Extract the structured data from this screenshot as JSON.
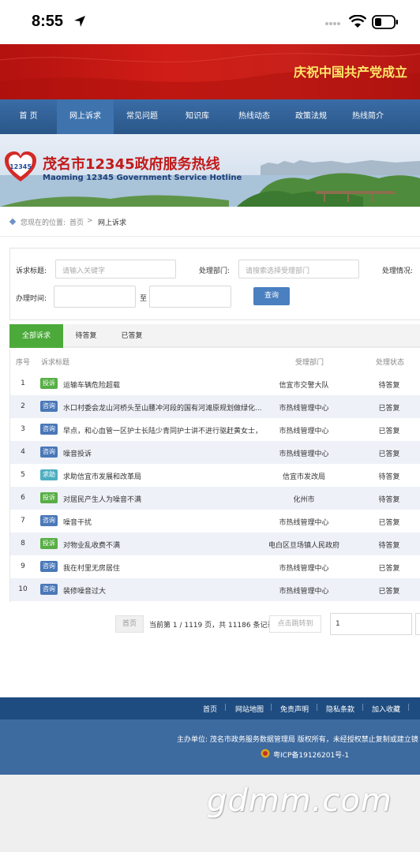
{
  "status_bar": {
    "time": "8:55"
  },
  "banner": {
    "slogan": "庆祝中国共产党成立"
  },
  "nav": {
    "items": [
      "首 页",
      "网上诉求",
      "常见问题",
      "知识库",
      "热线动态",
      "政策法规",
      "热线简介"
    ],
    "active": "网上诉求"
  },
  "hero": {
    "logo_text": "12345",
    "title": "茂名市12345政府服务热线",
    "subtitle": "Maoming 12345 Government Service Hotline"
  },
  "breadcrumb": {
    "prefix": "您现在的位置:",
    "home": "首页",
    "separator": ">",
    "current": "网上诉求"
  },
  "filters": {
    "title_label": "诉求标题:",
    "title_placeholder": "请输入关键字",
    "dept_label": "处理部门:",
    "dept_placeholder": "请搜索选择受理部门",
    "status_label": "处理情况:",
    "time_label": "办理时间:",
    "to_label": "至",
    "query_button": "查询"
  },
  "tabs": [
    "全部诉求",
    "待答复",
    "已答复"
  ],
  "table": {
    "headers": [
      "序号",
      "诉求标题",
      "受理部门",
      "处理状态"
    ],
    "rows": [
      {
        "no": "1",
        "tag": "投诉",
        "title": "运输车辆危险超载",
        "dept": "信宜市交警大队",
        "status": "待答复"
      },
      {
        "no": "2",
        "tag": "咨询",
        "title": "水口村委会龙山河桥头至山腰冲河段的国有河滩原规划做绿化...",
        "dept": "市热线管理中心",
        "status": "已答复"
      },
      {
        "no": "3",
        "tag": "咨询",
        "title": "早点，和心血管一区护士长陆少青同护士讲不进行驱赶黄女士，",
        "dept": "市热线管理中心",
        "status": "已答复"
      },
      {
        "no": "4",
        "tag": "咨询",
        "title": "噪音投诉",
        "dept": "市热线管理中心",
        "status": "已答复"
      },
      {
        "no": "5",
        "tag": "求助",
        "title": "求助信宜市发展和改革局",
        "dept": "信宜市发改局",
        "status": "待答复"
      },
      {
        "no": "6",
        "tag": "投诉",
        "title": "对居民产生人为噪音不满",
        "dept": "化州市",
        "status": "待答复"
      },
      {
        "no": "7",
        "tag": "咨询",
        "title": "噪音干扰",
        "dept": "市热线管理中心",
        "status": "已答复"
      },
      {
        "no": "8",
        "tag": "投诉",
        "title": "对物业乱收费不满",
        "dept": "电白区旦场镇人民政府",
        "status": "待答复"
      },
      {
        "no": "9",
        "tag": "咨询",
        "title": "我在村里无房居住",
        "dept": "市热线管理中心",
        "status": "已答复"
      },
      {
        "no": "10",
        "tag": "咨询",
        "title": "装修噪音过大",
        "dept": "市热线管理中心",
        "status": "已答复"
      }
    ]
  },
  "pagination": {
    "first": "首页",
    "info": "当前第 1 / 1119 页，共 11186 条记录。",
    "jump_placeholder": "点击跳转到",
    "page_value": "1"
  },
  "footer": {
    "links": [
      "首页",
      "网站地图",
      "免责声明",
      "隐私条款",
      "加入收藏"
    ],
    "host": "主办单位:   茂名市政务服务数据管理局 版权所有，未经授权禁止复制或建立镜",
    "icp": "粤ICP备19126201号-1"
  },
  "watermark": "gdmm.com",
  "colors": {
    "nav_bg": "#2e5e95",
    "banner_red": "#c8201a",
    "tab_active": "#4caa3a",
    "query_button": "#4a7fc0",
    "tag_complaint": "#58ae45",
    "tag_consult": "#4a78b8",
    "tag_help": "#4eaec0"
  }
}
